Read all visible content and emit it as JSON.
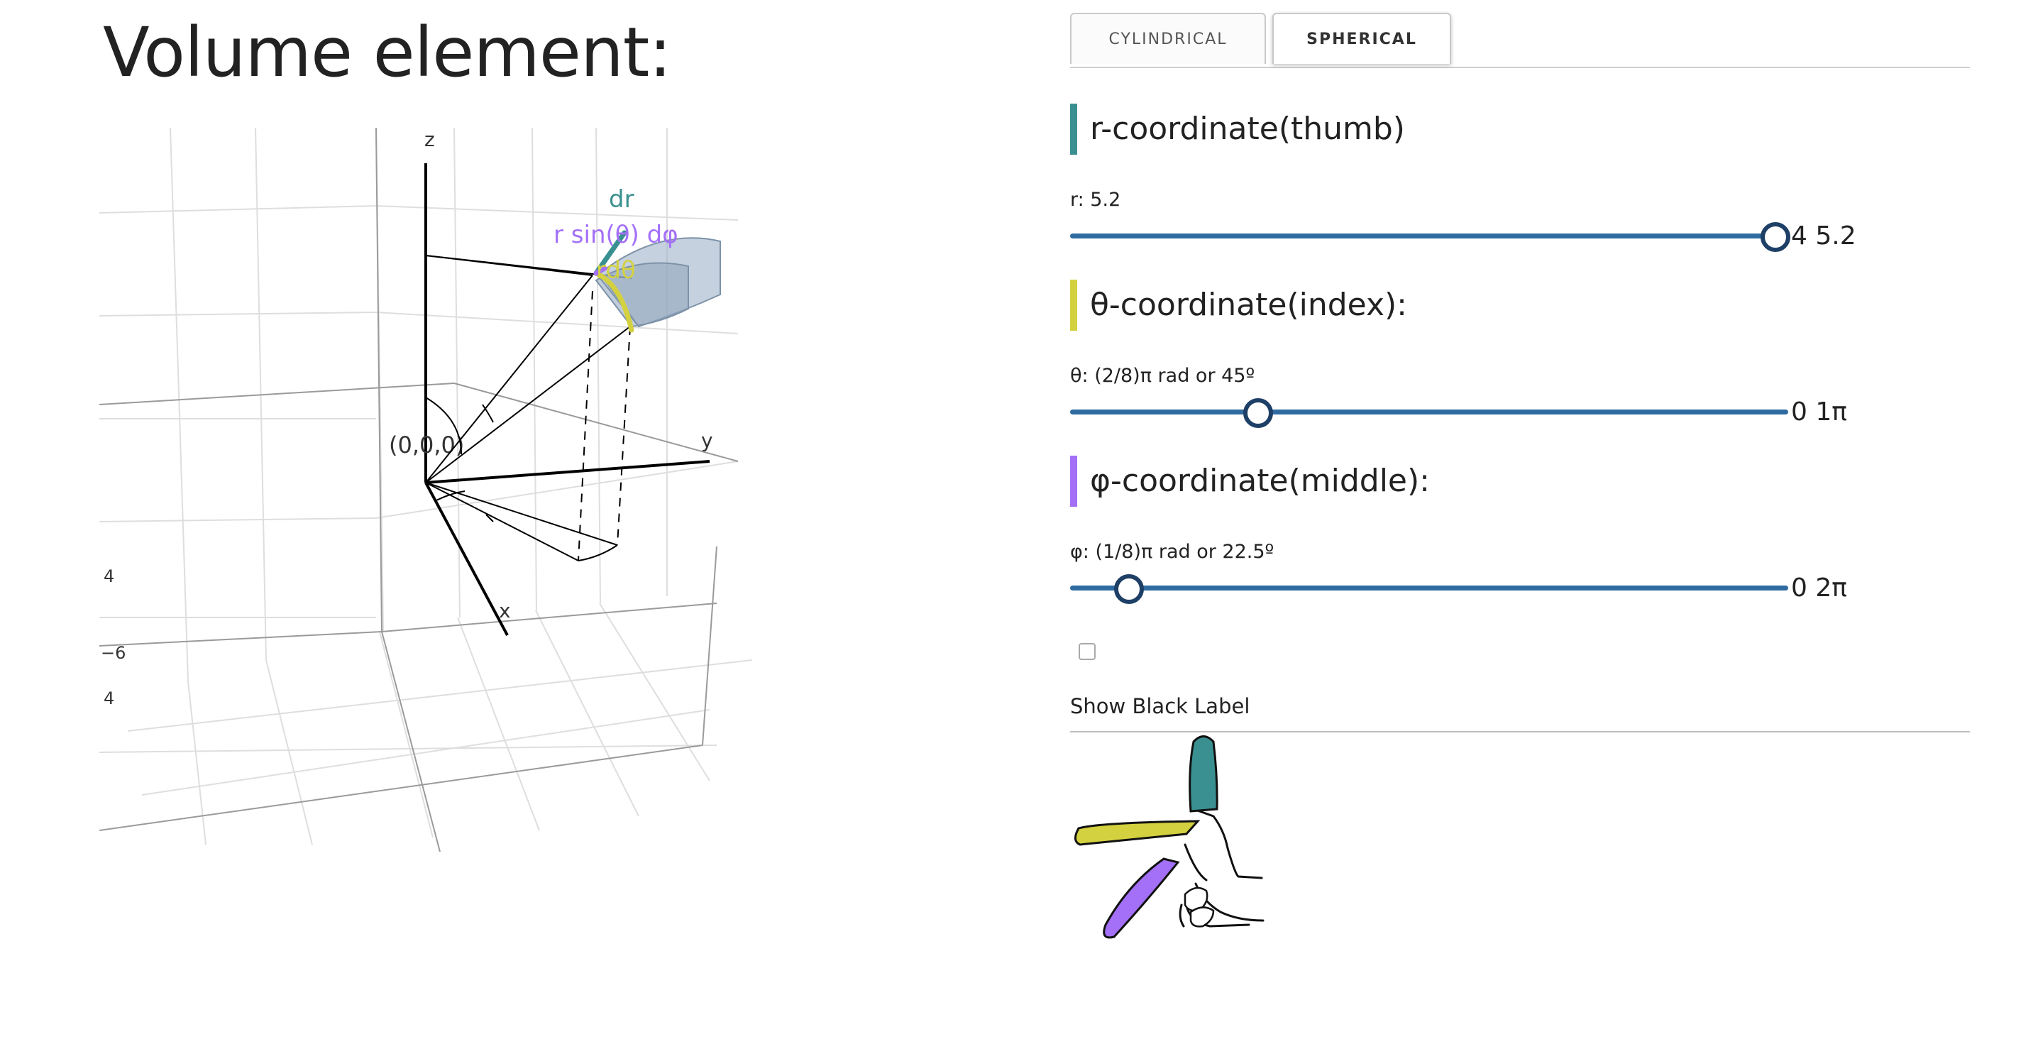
{
  "page": {
    "title": "Volume element:"
  },
  "tabs": [
    {
      "label": "CYLINDRICAL",
      "active": false
    },
    {
      "label": "SPHERICAL",
      "active": true
    }
  ],
  "plot": {
    "axis_labels": {
      "x": "x",
      "y": "y",
      "z": "z"
    },
    "origin_label": "(0,0,0)",
    "annotations": {
      "dr": "dr",
      "rdphi": "r sin(θ) dφ",
      "rdtheta": "rdθ"
    },
    "tick_labels": [
      "4",
      "−6",
      "4"
    ]
  },
  "sliders": {
    "r": {
      "heading": "r-coordinate(thumb)",
      "value_label": "r: 5.2",
      "min_label": "4",
      "max_label": "5.2",
      "fraction": 1.0,
      "color": "#3a9090"
    },
    "theta": {
      "heading": "θ-coordinate(index):",
      "value_label": "θ: (2/8)π rad or 45º",
      "min_label": "0",
      "max_label": "1π",
      "fraction": 0.25,
      "color": "#d4d140"
    },
    "phi": {
      "heading": "φ-coordinate(middle):",
      "value_label": "φ: (1/8)π rad or 22.5º",
      "min_label": "0",
      "max_label": "2π",
      "fraction": 0.0625,
      "color": "#a370f7"
    }
  },
  "checkbox": {
    "label": "Show Black Label",
    "checked": false
  },
  "colors": {
    "r": "#3a9090",
    "theta": "#d4d140",
    "phi": "#a370f7",
    "slider_track": "#2f6aa0",
    "slider_thumb": "#1e3f66"
  }
}
